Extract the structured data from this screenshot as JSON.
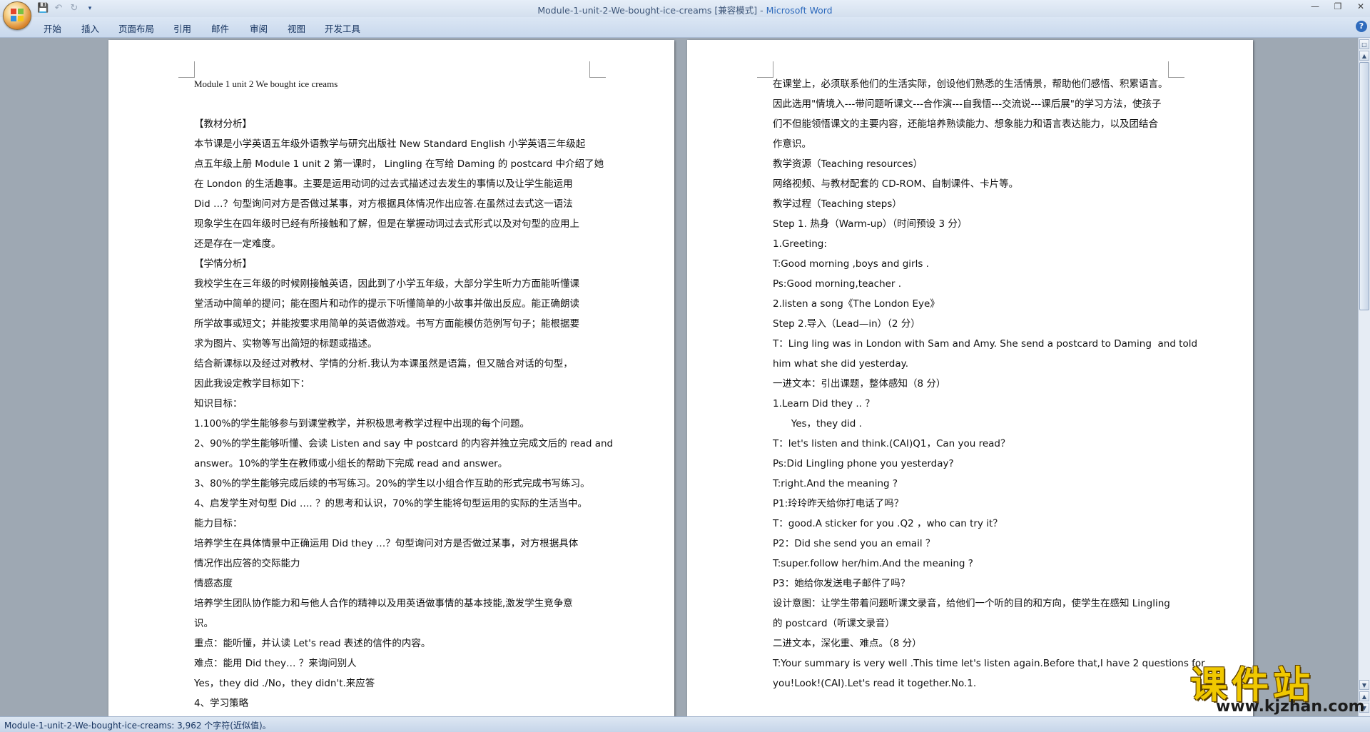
{
  "window": {
    "doc_name": "Module-1-unit-2-We-bought-ice-creams [兼容模式]",
    "separator": " - ",
    "app_name": "Microsoft Word"
  },
  "quick_access": {
    "save_icon": "save-icon",
    "undo_icon": "undo-icon",
    "redo_icon": "redo-icon",
    "customize_icon": "chevron-down-icon"
  },
  "ribbon_tabs": [
    "开始",
    "插入",
    "页面布局",
    "引用",
    "邮件",
    "审阅",
    "视图",
    "开发工具"
  ],
  "page1": {
    "lines": [
      "Module 1 unit 2 We bought ice creams",
      "",
      "【教材分析】",
      "本节课是小学英语五年级外语教学与研究出版社 New Standard English 小学英语三年级起",
      "点五年级上册 Module 1 unit 2 第一课时， Lingling 在写给 Daming 的 postcard 中介绍了她",
      "在 London 的生活趣事。主要是运用动词的过去式描述过去发生的事情以及让学生能运用",
      "Did …？句型询问对方是否做过某事，对方根据具体情况作出应答.在虽然过去式这一语法",
      "现象学生在四年级时已经有所接触和了解，但是在掌握动词过去式形式以及对句型的应用上",
      "还是存在一定难度。",
      "【学情分析】",
      "我校学生在三年级的时候刚接触英语，因此到了小学五年级，大部分学生听力方面能听懂课",
      "堂活动中简单的提问；能在图片和动作的提示下听懂简单的小故事并做出反应。能正确朗读",
      "所学故事或短文；并能按要求用简单的英语做游戏。书写方面能模仿范例写句子；能根据要",
      "求为图片、实物等写出简短的标题或描述。",
      "结合新课标以及经过对教材、学情的分析.我认为本课虽然是语篇，但又融合对话的句型，",
      "因此我设定教学目标如下：",
      "知识目标：",
      "1.100%的学生能够参与到课堂教学，并积极思考教学过程中出现的每个问题。",
      "2、90%的学生能够听懂、会读 Listen and say 中 postcard 的内容并独立完成文后的 read and",
      "answer。10%的学生在教师或小组长的帮助下完成 read and answer。",
      "3、80%的学生能够完成后续的书写练习。20%的学生以小组合作互助的形式完成书写练习。",
      "4、启发学生对句型 Did …. ？的思考和认识，70%的学生能将句型运用的实际的生活当中。",
      "能力目标：",
      "培养学生在具体情景中正确运用 Did they …？句型询问对方是否做过某事，对方根据具体",
      "情况作出应答的交际能力",
      "情感态度",
      "培养学生团队协作能力和与他人合作的精神以及用英语做事情的基本技能,激发学生竞争意",
      "识。",
      "重点：能听懂，并认读 Let's read 表述的信件的内容。",
      "难点：能用 Did they… ？来询问别人",
      "Yes，they did ./No，they didn't.来应答",
      "4、学习策略"
    ]
  },
  "page2": {
    "lines": [
      "在课堂上，必须联系他们的生活实际，创设他们熟悉的生活情景，帮助他们感悟、积累语言。",
      "因此选用\"情境入---带问题听课文---合作演---自我悟---交流说---课后展\"的学习方法，使孩子",
      "们不但能领悟课文的主要内容，还能培养熟读能力、想象能力和语言表达能力，以及团结合",
      "作意识。",
      "教学资源（Teaching resources）",
      "网络视频、与教材配套的 CD-ROM、自制课件、卡片等。",
      "教学过程（Teaching steps）",
      "Step 1. 热身（Warm-up）（时间预设 3 分）",
      "1.Greeting:",
      "T:Good morning ,boys and girls .",
      "Ps:Good morning,teacher .",
      "2.listen a song《The London Eye》",
      "Step 2.导入（Lead—in）（2 分）",
      "T：Ling ling was in London with Sam and Amy. She send a postcard to Daming  and told",
      "him what she did yesterday.",
      "一进文本：引出课题，整体感知（8 分）",
      "1.Learn Did they .. ？",
      "      Yes，they did .",
      "T：let's listen and think.(CAI)Q1，Can you read？",
      "Ps:Did Lingling phone you yesterday?",
      "T:right.And the meaning ?",
      "P1:玲玲昨天给你打电话了吗？",
      "T：good.A sticker for you .Q2 ，who can try it？",
      "P2：Did she send you an email ？",
      "T:super.follow her/him.And the meaning ?",
      "P3：她给你发送电子邮件了吗？",
      "设计意图：让学生带着问题听课文录音，给他们一个听的目的和方向，使学生在感知 Lingling",
      "的 postcard（听课文录音）",
      "二进文本，深化重、难点。（8 分）",
      "T:Your summary is very well .This time let's listen again.Before that,I have 2 questions for",
      "you!Look!(CAI).Let's read it together.No.1."
    ]
  },
  "statusbar": {
    "text": "Module-1-unit-2-We-bought-ice-creams: 3,962 个字符(近似值)。"
  },
  "watermark": {
    "title": "课件站",
    "url": "www.kjzhan.com"
  }
}
